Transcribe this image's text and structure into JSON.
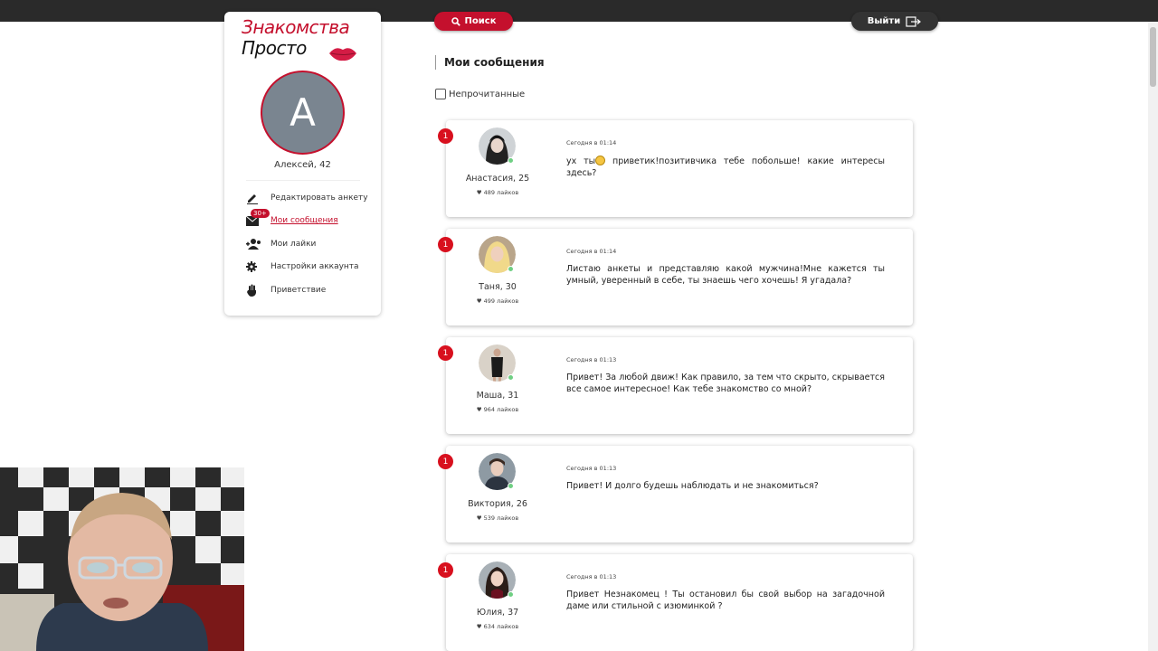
{
  "header": {
    "search_label": "Поиск",
    "logout_label": "Выйти"
  },
  "sidebar": {
    "logo_line1": "Знакомства",
    "logo_line2": "Просто",
    "avatar_letter": "А",
    "user_name": "Алексей, 42",
    "items": [
      {
        "label": "Редактировать анкету",
        "icon": "edit-icon"
      },
      {
        "label": "Мои сообщения",
        "icon": "envelope-icon",
        "badge": "30+",
        "active": true
      },
      {
        "label": "Мои лайки",
        "icon": "users-icon"
      },
      {
        "label": "Настройки аккаунта",
        "icon": "gear-icon"
      },
      {
        "label": "Приветствие",
        "icon": "hand-icon"
      }
    ]
  },
  "main": {
    "title": "Мои сообщения",
    "filter_label": "Непрочитанные",
    "messages": [
      {
        "unread": "1",
        "name": "Анастасия, 25",
        "likes": "♥ 489 лайков",
        "time": "Сегодня в 01:14",
        "text_before": "ух ты",
        "text_after": " приветик!позитивчика тебе побольше! какие интересы здесь?",
        "emoji": true
      },
      {
        "unread": "1",
        "name": "Таня, 30",
        "likes": "♥ 499 лайков",
        "time": "Сегодня в 01:14",
        "text": "Листаю анкеты и представляю какой мужчина!Мне кажется ты умный, уверенный в себе, ты знаешь чего хочешь! Я угадала?"
      },
      {
        "unread": "1",
        "name": "Маша, 31",
        "likes": "♥ 964 лайков",
        "time": "Сегодня в 01:13",
        "text": "Привет! За любой движ! Как правило, за тем что скрыто, скрывается все самое интересное! Как тебе знакомство со мной?"
      },
      {
        "unread": "1",
        "name": "Виктория, 26",
        "likes": "♥ 539 лайков",
        "time": "Сегодня в 01:13",
        "text": "Привет! И долго будешь наблюдать и не знакомиться?"
      },
      {
        "unread": "1",
        "name": "Юлия, 37",
        "likes": "♥ 634 лайков",
        "time": "Сегодня в 01:13",
        "text": "Привет Незнакомец ! Ты остановил бы свой выбор на загадочной даме или стильной с изюминкой ?"
      }
    ]
  },
  "colors": {
    "accent": "#c4102d",
    "topbar": "#2a2a2a",
    "online": "#6fcf83"
  }
}
